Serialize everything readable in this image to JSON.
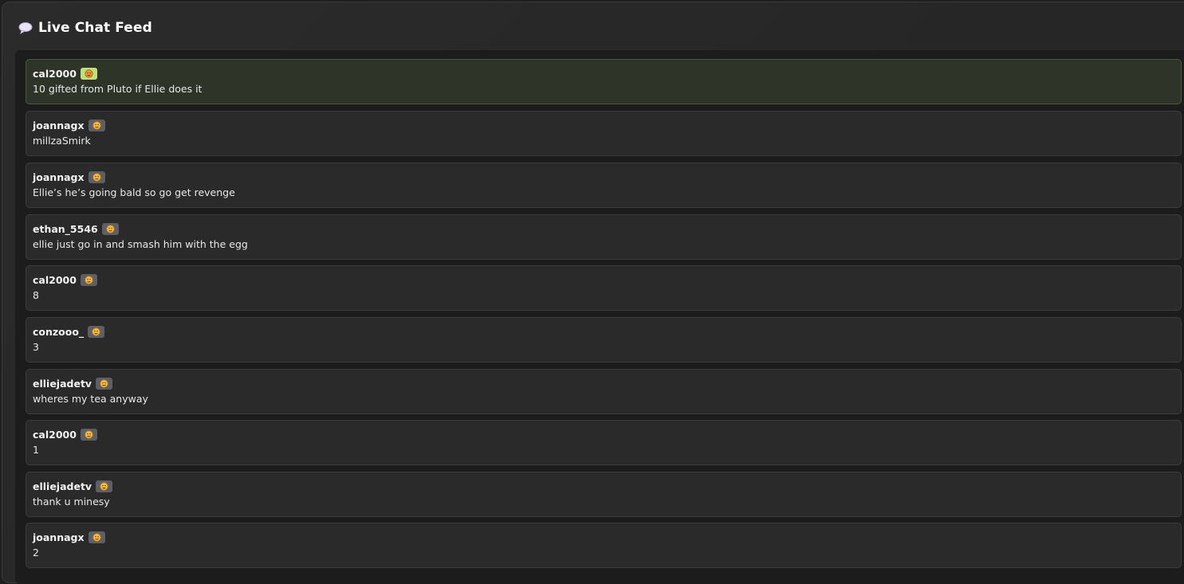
{
  "header": {
    "icon": "speech-bubble-icon",
    "title": "Live Chat Feed"
  },
  "colors": {
    "highlight_badge": "#b9e27a",
    "default_badge": "#5e5e66",
    "highlight_bg": "#2f3428"
  },
  "messages": [
    {
      "user": "cal2000",
      "badge_icon": "face-emoji-icon",
      "text": "10 gifted from Pluto if Ellie does it",
      "highlighted": true
    },
    {
      "user": "joannagx",
      "badge_icon": "face-emoji-icon",
      "text": "millzaSmirk",
      "highlighted": false
    },
    {
      "user": "joannagx",
      "badge_icon": "face-emoji-icon",
      "text": "Ellie’s he’s going bald so go get revenge",
      "highlighted": false
    },
    {
      "user": "ethan_5546",
      "badge_icon": "face-emoji-icon",
      "text": "ellie just go in and smash him with the egg",
      "highlighted": false
    },
    {
      "user": "cal2000",
      "badge_icon": "face-emoji-icon",
      "text": "8",
      "highlighted": false
    },
    {
      "user": "conzooo_",
      "badge_icon": "face-emoji-icon",
      "text": "3",
      "highlighted": false
    },
    {
      "user": "elliejadetv",
      "badge_icon": "face-emoji-icon",
      "text": "wheres my tea anyway",
      "highlighted": false
    },
    {
      "user": "cal2000",
      "badge_icon": "face-emoji-icon",
      "text": "1",
      "highlighted": false
    },
    {
      "user": "elliejadetv",
      "badge_icon": "face-emoji-icon",
      "text": "thank u minesy",
      "highlighted": false
    },
    {
      "user": "joannagx",
      "badge_icon": "face-emoji-icon",
      "text": "2",
      "highlighted": false
    }
  ]
}
